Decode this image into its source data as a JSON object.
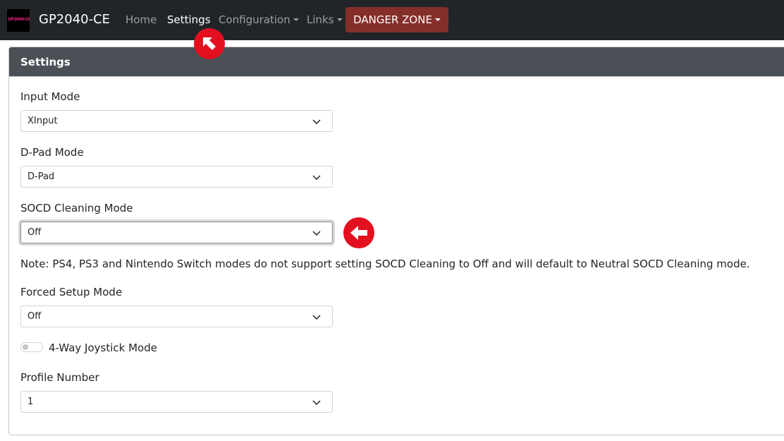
{
  "navbar": {
    "logo_text": "GP2040-CE",
    "brand": "GP2040-CE",
    "links": [
      {
        "label": "Home",
        "active": false,
        "dropdown": false
      },
      {
        "label": "Settings",
        "active": true,
        "dropdown": false
      },
      {
        "label": "Configuration",
        "active": false,
        "dropdown": true
      },
      {
        "label": "Links",
        "active": false,
        "dropdown": true
      }
    ],
    "danger_label": "DANGER ZONE"
  },
  "card": {
    "title": "Settings",
    "fields": {
      "input_mode": {
        "label": "Input Mode",
        "value": "XInput"
      },
      "dpad_mode": {
        "label": "D-Pad Mode",
        "value": "D-Pad"
      },
      "socd_mode": {
        "label": "SOCD Cleaning Mode",
        "value": "Off"
      },
      "forced_setup": {
        "label": "Forced Setup Mode",
        "value": "Off"
      },
      "profile_number": {
        "label": "Profile Number",
        "value": "1"
      }
    },
    "note": "Note: PS4, PS3 and Nintendo Switch modes do not support setting SOCD Cleaning to Off and will default to Neutral SOCD Cleaning mode.",
    "joystick_toggle": {
      "label": "4-Way Joystick Mode",
      "on": false
    }
  },
  "colors": {
    "navbar_bg": "#212529",
    "danger": "#842f2a",
    "card_header": "#4a5056",
    "marker": "#e4101f"
  },
  "icons": {
    "select_indicator": "chevron-down-icon",
    "annotation_settings": "arrow-up-left-icon",
    "annotation_socd": "arrow-left-icon",
    "toggle": "toggle-switch-icon"
  }
}
